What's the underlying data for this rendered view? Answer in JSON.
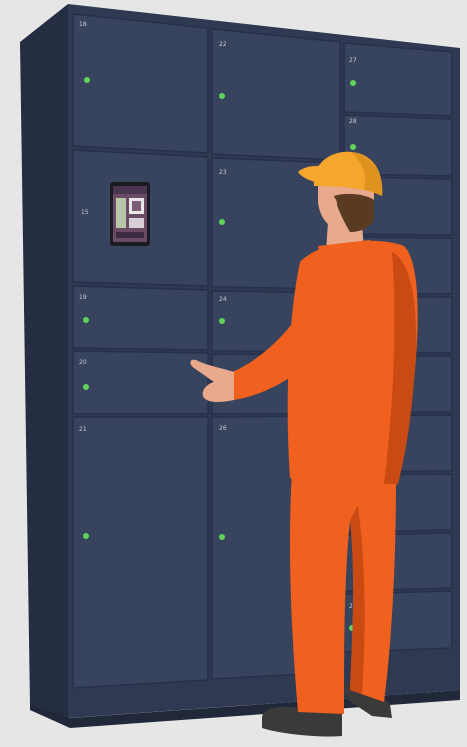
{
  "scene": {
    "description_free": true,
    "colors": {
      "background": "#e6e6e6",
      "cabinet_body": "#2f3a52",
      "cabinet_side": "#242d42",
      "door": "#38445e",
      "door_edge": "#27304a",
      "indicator": "#5fd35a",
      "worker_suit": "#f0601e",
      "worker_suit_shadow": "#c94a12",
      "worker_cap": "#f5a62c",
      "worker_skin": "#e8a98c",
      "worker_hair": "#5a3a22",
      "boots": "#3a3a3a"
    }
  },
  "lockers": {
    "labels": {
      "l18": "18",
      "l22": "22",
      "l27": "27",
      "l28": "28",
      "l15": "15",
      "l23": "23",
      "l19": "19",
      "l24": "24",
      "l20": "20",
      "l21": "21",
      "l26": "26",
      "l29": "29"
    }
  },
  "icons": {
    "terminal": "touchscreen-terminal-icon",
    "indicator": "led-indicator-icon"
  }
}
